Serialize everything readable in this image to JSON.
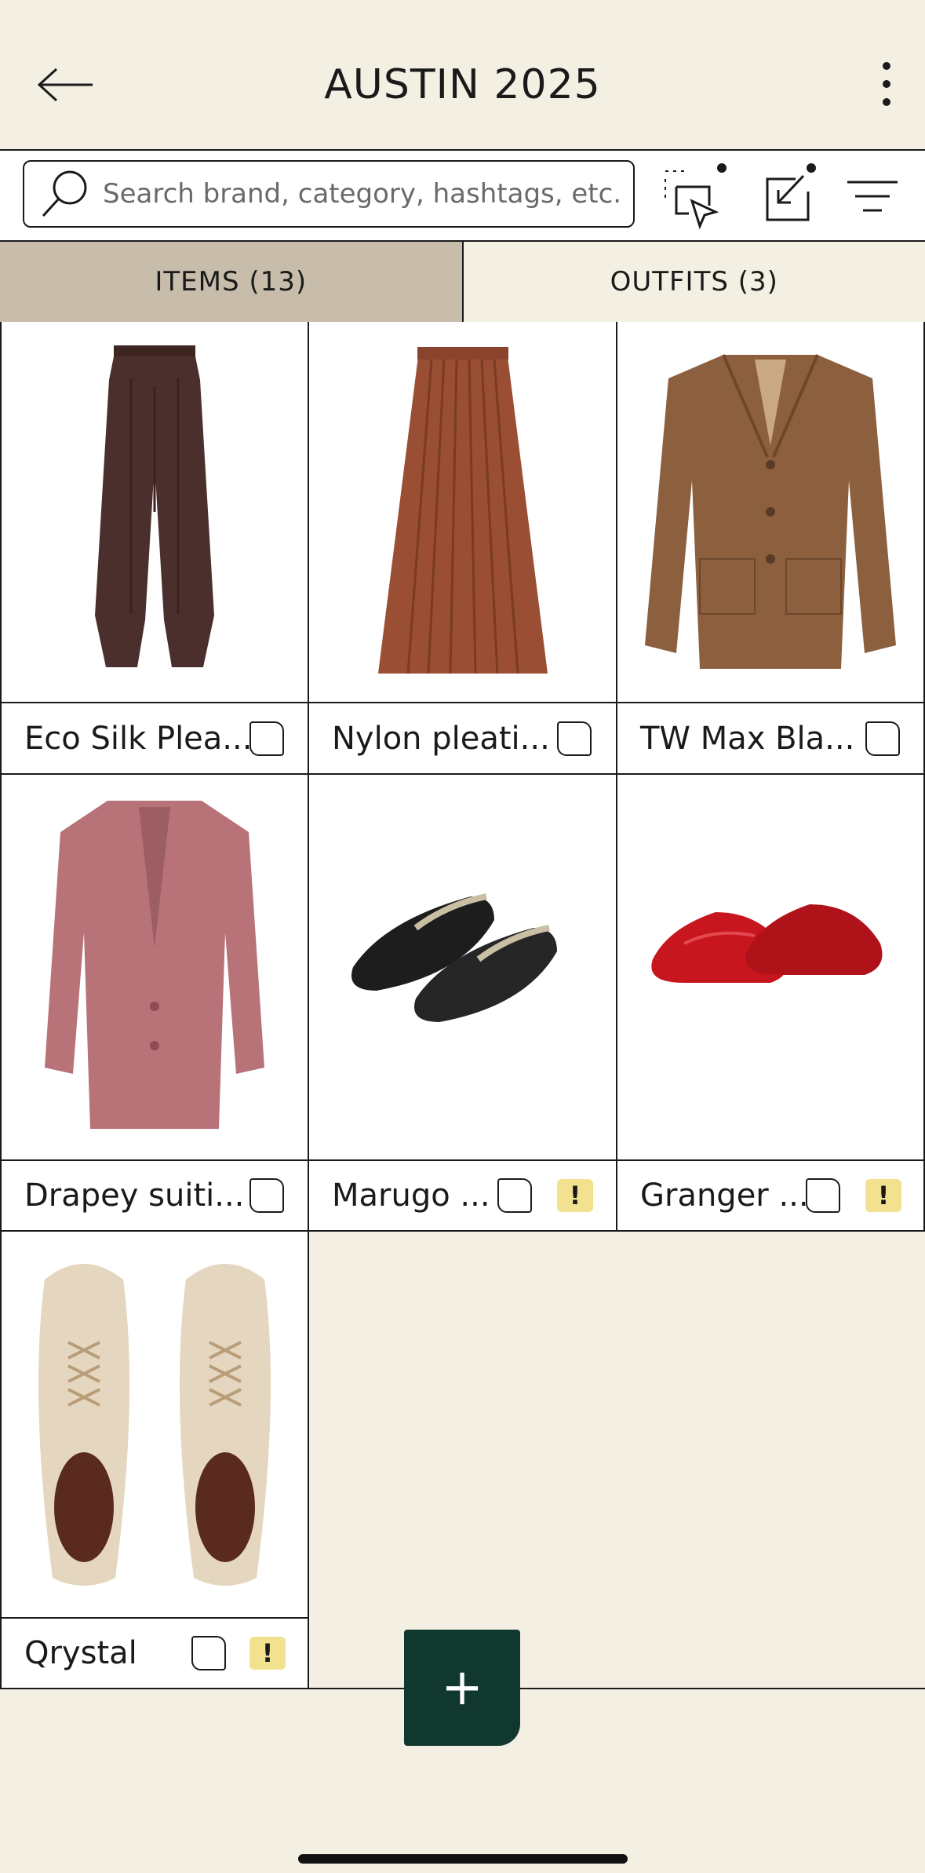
{
  "header": {
    "title": "AUSTIN 2025"
  },
  "search": {
    "placeholder": "Search brand, category, hashtags, etc."
  },
  "tabs": [
    {
      "label": "ITEMS (13)",
      "active": true
    },
    {
      "label": "OUTFITS (3)",
      "active": false
    }
  ],
  "items": [
    {
      "name": "Eco Silk Plea...",
      "warning": false
    },
    {
      "name": "Nylon pleati...",
      "warning": false
    },
    {
      "name": "TW Max Bla...",
      "warning": false
    },
    {
      "name": "Drapey suiti...",
      "warning": false
    },
    {
      "name": "Marugo ...",
      "warning": true,
      "warning_label": "!"
    },
    {
      "name": "Granger ...",
      "warning": true,
      "warning_label": "!"
    },
    {
      "name": "Qrystal",
      "warning": true,
      "warning_label": "!"
    }
  ],
  "fab": {
    "label": "+"
  },
  "colors": {
    "background": "#f4efe3",
    "active_tab": "#c8bdaa",
    "fab": "#11382f",
    "warning": "#f2e18e"
  }
}
